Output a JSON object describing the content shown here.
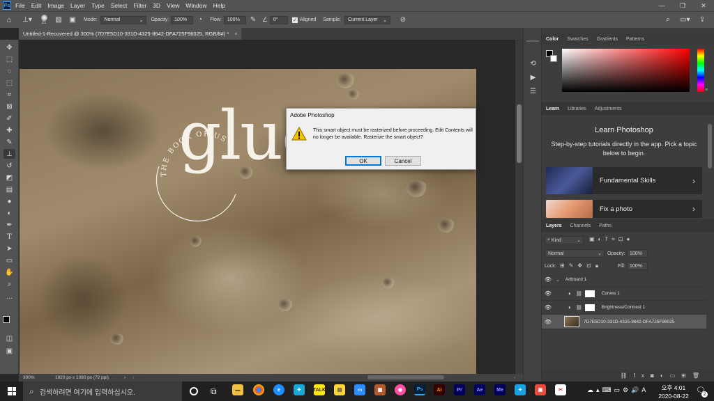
{
  "menubar": {
    "logo": "Ps",
    "items": [
      "File",
      "Edit",
      "Image",
      "Layer",
      "Type",
      "Select",
      "Filter",
      "3D",
      "View",
      "Window",
      "Help"
    ]
  },
  "options": {
    "brush_size": "21",
    "mode_label": "Mode:",
    "mode_value": "Normal",
    "opacity_label": "Opacity:",
    "opacity_value": "100%",
    "flow_label": "Flow:",
    "flow_value": "100%",
    "angle_value": "0°",
    "aligned_label": "Aligned",
    "sample_label": "Sample:",
    "sample_value": "Current Layer"
  },
  "document": {
    "tab_title": "Untitled-1-Recovered @ 300% (7D7E5D10-331D-4325-8642-DFA725F96025, RGB/8#) *",
    "close": "×"
  },
  "artwork": {
    "circle_text": "THE BOOK OF US",
    "big_word": "gluon"
  },
  "status": {
    "zoom": "300%",
    "doc_size": "1920 px x 1080 px (72 ppi)",
    "arrow": "›"
  },
  "dialog": {
    "title": "Adobe Photoshop",
    "message": "This smart object must be rasterized before proceeding.  Edit Contents will no longer be available.  Rasterize the smart object?",
    "ok": "OK",
    "cancel": "Cancel"
  },
  "color_panel": {
    "tabs": [
      "Color",
      "Swatches",
      "Gradients",
      "Patterns"
    ]
  },
  "learn_panel": {
    "tabs": [
      "Learn",
      "Libraries",
      "Adjustments"
    ],
    "heading": "Learn Photoshop",
    "description": "Step-by-step tutorials directly in the app. Pick a topic below to begin.",
    "cards": [
      {
        "label": "Fundamental Skills"
      },
      {
        "label": "Fix a photo"
      }
    ]
  },
  "layers_panel": {
    "tabs": [
      "Layers",
      "Channels",
      "Paths"
    ],
    "filter_kind": "Kind",
    "blend_mode": "Normal",
    "opacity_label": "Opacity:",
    "opacity_value": "100%",
    "lock_label": "Lock:",
    "fill_label": "Fill:",
    "fill_value": "100%",
    "layers": [
      {
        "name": "Artboard 1"
      },
      {
        "name": "Curves 1"
      },
      {
        "name": "Brightness/Contrast 1"
      },
      {
        "name": "7D7E5D10-331D-4325-8642-DFA725F96025"
      }
    ]
  },
  "taskbar": {
    "search_placeholder": "검색하려면 여기에 입력하십시오.",
    "time": "오후 4:01",
    "date": "2020-08-22",
    "notif_count": "2",
    "apps": [
      "Ps",
      "Ai",
      "Pr",
      "Ae",
      "Me"
    ]
  },
  "colors": {
    "ps_blue": "#31a8ff",
    "ai_orange": "#ff9a00",
    "pr_purple": "#9999ff",
    "ae_purple": "#9999ff",
    "me_purple": "#9999ff"
  }
}
